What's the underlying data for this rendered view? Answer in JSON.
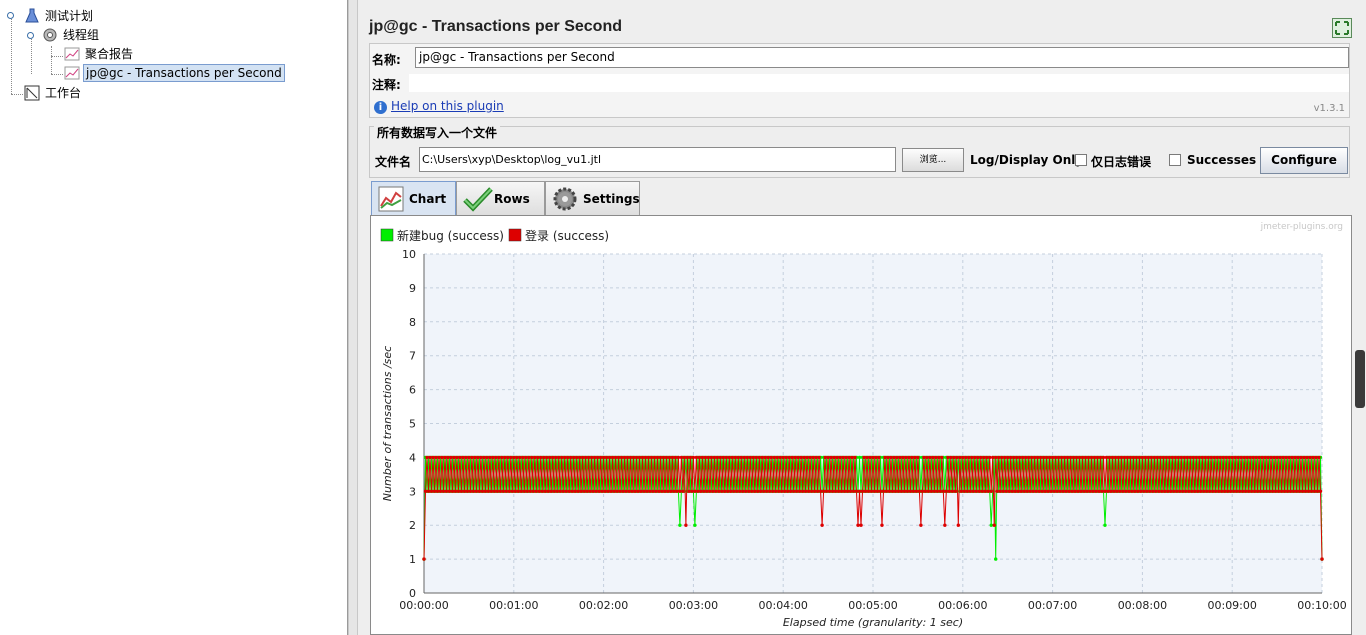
{
  "tree": {
    "items": [
      {
        "label": "测试计划"
      },
      {
        "label": "线程组"
      },
      {
        "label": "聚合报告"
      },
      {
        "label": "jp@gc - Transactions per Second"
      },
      {
        "label": "工作台"
      }
    ]
  },
  "panel": {
    "title": "jp@gc - Transactions per Second",
    "name_label": "名称:",
    "name_value": "jp@gc - Transactions per Second",
    "comment_label": "注释:",
    "help_link": "Help on this plugin",
    "version": "v1.3.1"
  },
  "file_section": {
    "legend": "所有数据写入一个文件",
    "file_label": "文件名",
    "file_value": "C:\\Users\\xyp\\Desktop\\log_vu1.jtl",
    "browse_label": "浏览...",
    "log_display_label": "Log/Display Only:",
    "errors_only_label": "仅日志错误",
    "successes_label": "Successes",
    "configure_label": "Configure"
  },
  "tabs": [
    {
      "label": "Chart",
      "active": true
    },
    {
      "label": "Rows",
      "active": false
    },
    {
      "label": "Settings",
      "active": false
    }
  ],
  "watermark": "jmeter-plugins.org",
  "colors": {
    "series_green": "#00ee00",
    "series_red": "#dd0000"
  },
  "chart_data": {
    "type": "line",
    "xlabel": "Elapsed time (granularity: 1 sec)",
    "ylabel": "Number of transactions /sec",
    "ylim": [
      0,
      10
    ],
    "xlim_seconds": [
      0,
      600
    ],
    "x_ticks": [
      "00:00:00",
      "00:01:00",
      "00:02:00",
      "00:03:00",
      "00:04:00",
      "00:05:00",
      "00:06:00",
      "00:07:00",
      "00:08:00",
      "00:09:00",
      "00:10:00"
    ],
    "y_ticks": [
      0,
      1,
      2,
      3,
      4,
      5,
      6,
      7,
      8,
      9,
      10
    ],
    "grid": true,
    "legend_position": "top-left",
    "series": [
      {
        "name": "新建bug (success)",
        "color": "#00ee00",
        "pattern": "alternating 3 and 4 each second",
        "dips": [
          {
            "t": 171,
            "v": 2
          },
          {
            "t": 181,
            "v": 2
          },
          {
            "t": 379,
            "v": 2
          },
          {
            "t": 382,
            "v": 1
          },
          {
            "t": 455,
            "v": 2
          }
        ],
        "start": {
          "t": 0,
          "v": 1
        },
        "end": {
          "t": 600,
          "v": 1
        }
      },
      {
        "name": "登录 (success)",
        "color": "#dd0000",
        "pattern": "alternating 4 and 3 each second",
        "dips": [
          {
            "t": 175,
            "v": 2
          },
          {
            "t": 266,
            "v": 2
          },
          {
            "t": 290,
            "v": 2
          },
          {
            "t": 292,
            "v": 2
          },
          {
            "t": 306,
            "v": 2
          },
          {
            "t": 332,
            "v": 2
          },
          {
            "t": 348,
            "v": 2
          },
          {
            "t": 357,
            "v": 2
          },
          {
            "t": 381,
            "v": 2
          }
        ],
        "start": {
          "t": 0,
          "v": 1
        },
        "end": {
          "t": 600,
          "v": 1
        }
      }
    ]
  }
}
